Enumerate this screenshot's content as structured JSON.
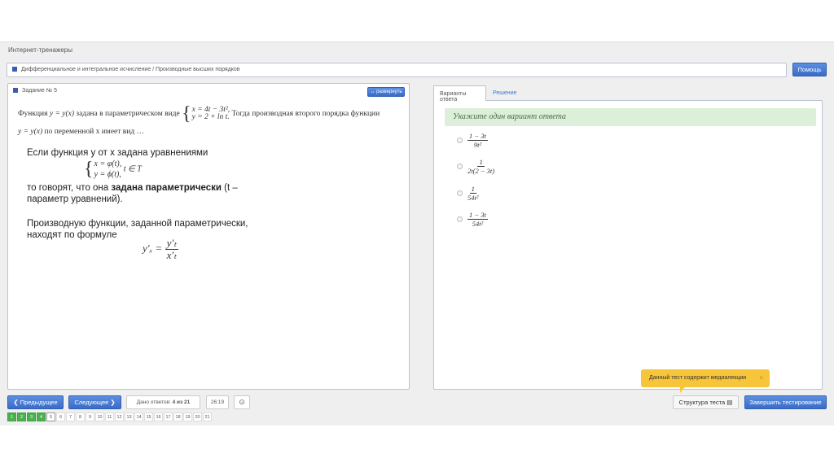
{
  "app_title": "Интернет-тренажеры",
  "breadcrumb": "Дифференциальное и интегральное исчисление / Производные высших порядков",
  "help_label": "Помощь",
  "task": {
    "title": "Задание № 5",
    "expand_label": "↔ развернуть",
    "text1": "Функция",
    "func": "y = y(x)",
    "text2": "задана в параметрическом виде",
    "eq1": "x = 4t − 3t²,",
    "eq2": "y = 2 + ln t.",
    "text3": "Тогда производная второго порядка функции",
    "func2": "y = y(x)",
    "text4": "по переменной x имеет вид …"
  },
  "theory": {
    "line1": "Если функция y от x задана уравнениями",
    "eq1": "x = φ(t),",
    "eq2": "y = ϕ(t),",
    "domain": "t ∈ T",
    "line2a": "то говорят, что она ",
    "line2b": "задана параметрически",
    "line2c": " (t –",
    "line3": "параметр уравнений).",
    "line4": "Производную функции, заданной параметрически,",
    "line5": "находят по формуле",
    "lhs": "y′ₓ =",
    "num": "y′ₜ",
    "den": "x′ₜ"
  },
  "tabs": [
    {
      "label": "Варианты ответа"
    },
    {
      "label": "Решение"
    }
  ],
  "hint": "Укажите один вариант ответа",
  "options": [
    {
      "num": "1 − 3t",
      "den": "9t²"
    },
    {
      "num": "1",
      "den": "2t(2 − 3t)"
    },
    {
      "num": "1",
      "den": "54t²"
    },
    {
      "num": "1 − 3t",
      "den": "54t²"
    }
  ],
  "footer": {
    "prev_label": "❮ Предыдущее",
    "next_label": "Следующее ❯",
    "answered_label": "Дано ответов: ",
    "answered_value": "4 из 21",
    "timer": "26:19",
    "clock_icon": "⊙",
    "structure_label": "Структура теста ▤",
    "finish_label": "Завершить тестирование",
    "tooltip": "Данный тест содержит медиалекции",
    "tooltip_close": "×"
  },
  "pages": [
    "1",
    "2",
    "3",
    "4",
    "5",
    "6",
    "7",
    "8",
    "9",
    "10",
    "11",
    "12",
    "13",
    "14",
    "15",
    "16",
    "17",
    "18",
    "19",
    "20",
    "21"
  ],
  "answered_pages": 4,
  "current_page": 5
}
